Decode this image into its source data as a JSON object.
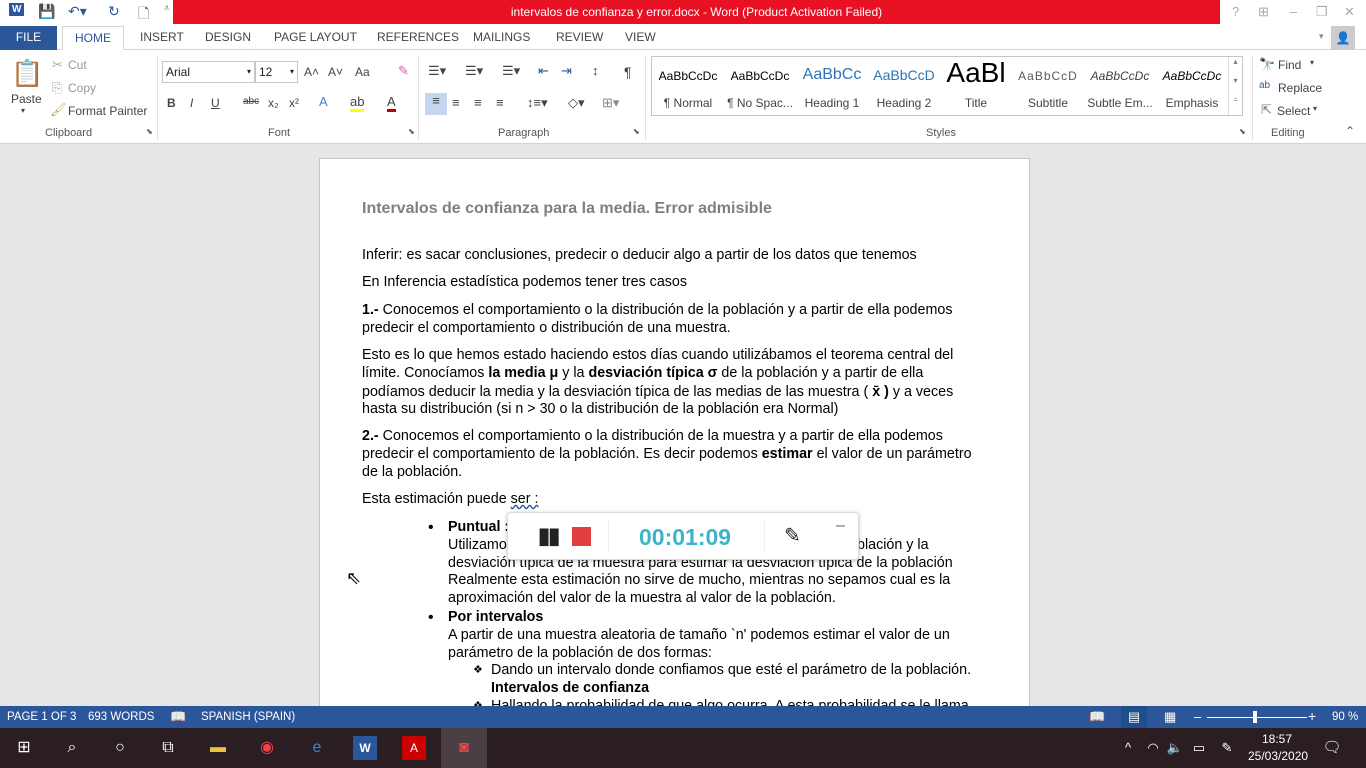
{
  "window": {
    "title": "intervalos de confianza y error.docx -  Word (Product Activation Failed)",
    "help": "?",
    "minimize": "–",
    "restore": "❐",
    "close": "✕"
  },
  "tabs": [
    "FILE",
    "HOME",
    "INSERT",
    "DESIGN",
    "PAGE LAYOUT",
    "REFERENCES",
    "MAILINGS",
    "REVIEW",
    "VIEW"
  ],
  "clipboard": {
    "paste": "Paste",
    "cut": "Cut",
    "copy": "Copy",
    "format_painter": "Format Painter",
    "group": "Clipboard"
  },
  "font": {
    "name": "Arial",
    "size": "12",
    "group": "Font",
    "bold": "B",
    "italic": "I",
    "underline": "U",
    "strike": "abc",
    "sub": "x₂",
    "sup": "x²",
    "grow": "A˄",
    "shrink": "A˅",
    "case": "Aa"
  },
  "paragraph": {
    "group": "Paragraph",
    "pilcrow": "¶"
  },
  "styles": {
    "group": "Styles",
    "items": [
      {
        "preview": "AaBbCcDc",
        "name": "¶ Normal"
      },
      {
        "preview": "AaBbCcDc",
        "name": "¶ No Spac..."
      },
      {
        "preview": "AaBbCc",
        "name": "Heading 1"
      },
      {
        "preview": "AaBbCcD",
        "name": "Heading 2"
      },
      {
        "preview": "AaBl",
        "name": "Title"
      },
      {
        "preview": "AaBbCcD",
        "name": "Subtitle"
      },
      {
        "preview": "AaBbCcDc",
        "name": "Subtle Em..."
      },
      {
        "preview": "AaBbCcDc",
        "name": "Emphasis"
      }
    ]
  },
  "editing": {
    "group": "Editing",
    "find": "Find",
    "replace": "Replace",
    "select": "Select"
  },
  "document": {
    "lines": [
      [
        {
          "t": "Intervalos de confianza para la media. Error admisible"
        }
      ],
      [
        {
          "t": "Inferir: es sacar conclusiones, predecir  o deducir algo a partir de los datos que tenemos"
        }
      ],
      [
        {
          "t": "En Inferencia estadística podemos tener tres casos"
        }
      ],
      [
        {
          "t": "1.-",
          "b": 1
        },
        {
          "t": " Conocemos el comportamiento o la distribución de la población  y  a partir de ella podemos"
        }
      ],
      [
        {
          "t": "predecir el comportamiento o distribución de una muestra."
        }
      ],
      [
        {
          "t": "   Esto es lo que hemos estado haciendo estos días cuando utilizábamos el teorema central del"
        }
      ],
      [
        {
          "t": "límite. Conocíamos "
        },
        {
          "t": "la media μ",
          "b": 1
        },
        {
          "t": " y la "
        },
        {
          "t": "desviación típica σ",
          "b": 1
        },
        {
          "t": " de la población y a partir de ella"
        }
      ],
      [
        {
          "t": "podíamos deducir la media y la desviación típica  de las medias de las muestra ( "
        },
        {
          "t": "x̄ )",
          "b": 1
        },
        {
          "t": "   y  a veces"
        }
      ],
      [
        {
          "t": "hasta su distribución (si n > 30 o la distribución de la población era Normal)"
        }
      ],
      [
        {
          "t": "2.-",
          "b": 1
        },
        {
          "t": " Conocemos el comportamiento o la distribución de la muestra  y  a partir de ella podemos"
        }
      ],
      [
        {
          "t": "predecir el comportamiento de la población. Es decir podemos "
        },
        {
          "t": "estimar",
          "b": 1
        },
        {
          "t": " el valor de un parámetro"
        }
      ],
      [
        {
          "t": "de la población."
        }
      ],
      [
        {
          "t": "Esta estimación puede "
        },
        {
          "t": "ser :",
          "u": 1
        }
      ],
      [
        {
          "t": "Puntual :",
          "b": 1
        }
      ],
      [
        {
          "t": "Utilizamo"
        }
      ],
      [
        {
          "t": "desviación típica de la muestra para estimar la desviación típica de la población"
        }
      ],
      [
        {
          "t": "Realmente esta estimación no sirve de mucho, mientras no sepamos cual es la"
        }
      ],
      [
        {
          "t": "aproximación del valor de la muestra al valor de la población."
        }
      ],
      [
        {
          "t": "Por intervalos",
          "b": 1
        }
      ],
      [
        {
          "t": "A partir de una muestra aleatoria de tamaño `n' podemos estimar el valor de un"
        }
      ],
      [
        {
          "t": "parámetro de la población de dos formas:"
        }
      ],
      [
        {
          "t": "Dando un intervalo donde confiamos que esté el parámetro de la población."
        }
      ],
      [
        {
          "t": "Intervalos de confianza",
          "b": 1
        }
      ],
      [
        {
          "t": "Hallando la probabilidad de que algo ocurra. A esta probabilidad se le llama"
        }
      ]
    ],
    "partial_right": "blación y la"
  },
  "recorder": {
    "time": "00:01:09"
  },
  "status": {
    "page": "PAGE 1 OF 3",
    "words": "693 WORDS",
    "language": "SPANISH (SPAIN)",
    "zoom": "90 %",
    "zoom_percent": 90
  },
  "taskbar": {
    "time": "18:57",
    "date": "25/03/2020"
  },
  "colors": {
    "accent": "#2b579a",
    "title_red": "#e81123",
    "timer": "#3db4c8",
    "stop": "#e04040"
  }
}
